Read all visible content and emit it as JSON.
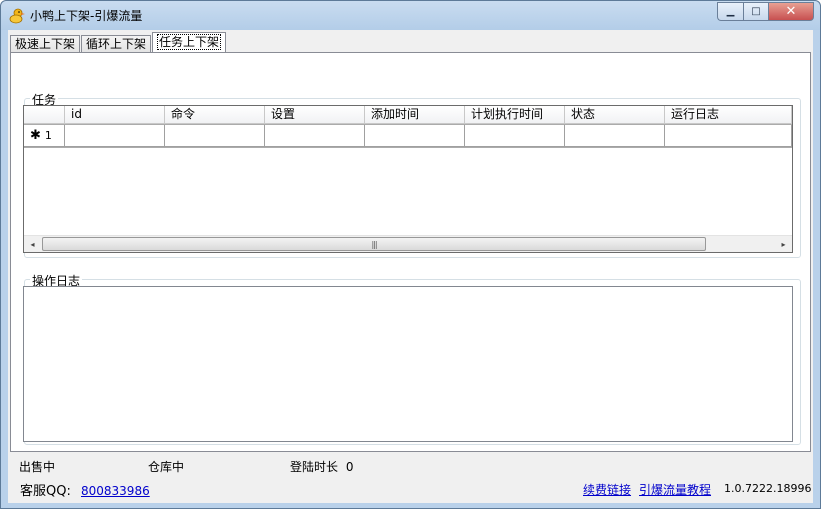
{
  "window": {
    "title": "小鸭上下架-引爆流量",
    "caption": {
      "minimize": "▁",
      "maximize": "□",
      "close": "✕"
    }
  },
  "tabs": [
    {
      "label": "极速上下架",
      "active": false
    },
    {
      "label": "循环上下架",
      "active": false
    },
    {
      "label": "任务上下架",
      "active": true
    }
  ],
  "task_group": {
    "title": "任务",
    "columns": [
      "id",
      "命令",
      "设置",
      "添加时间",
      "计划执行时间",
      "状态",
      "运行日志"
    ],
    "new_row": {
      "marker": "✱",
      "number": "1"
    },
    "scrollbar": {
      "left_arrow": "◂",
      "right_arrow": "▸",
      "grip": "|||"
    }
  },
  "log_group": {
    "title": "操作日志"
  },
  "status": {
    "selling": "出售中",
    "warehouse": "仓库中",
    "login_duration_label": "登陆时长",
    "login_duration_value": "0",
    "support_label": "客服QQ:",
    "support_qq": "800833986",
    "renew_link": "续费链接",
    "tutorial_link": "引爆流量教程",
    "version": "1.0.7222.18996"
  },
  "colors": {
    "link": "#0000cc",
    "title_bar": "#b9d1ea",
    "close_button": "#c75050"
  },
  "icons": {
    "app": "duck-icon",
    "grid_scroll_left": "chevron-left-icon",
    "grid_scroll_right": "chevron-right-icon"
  }
}
